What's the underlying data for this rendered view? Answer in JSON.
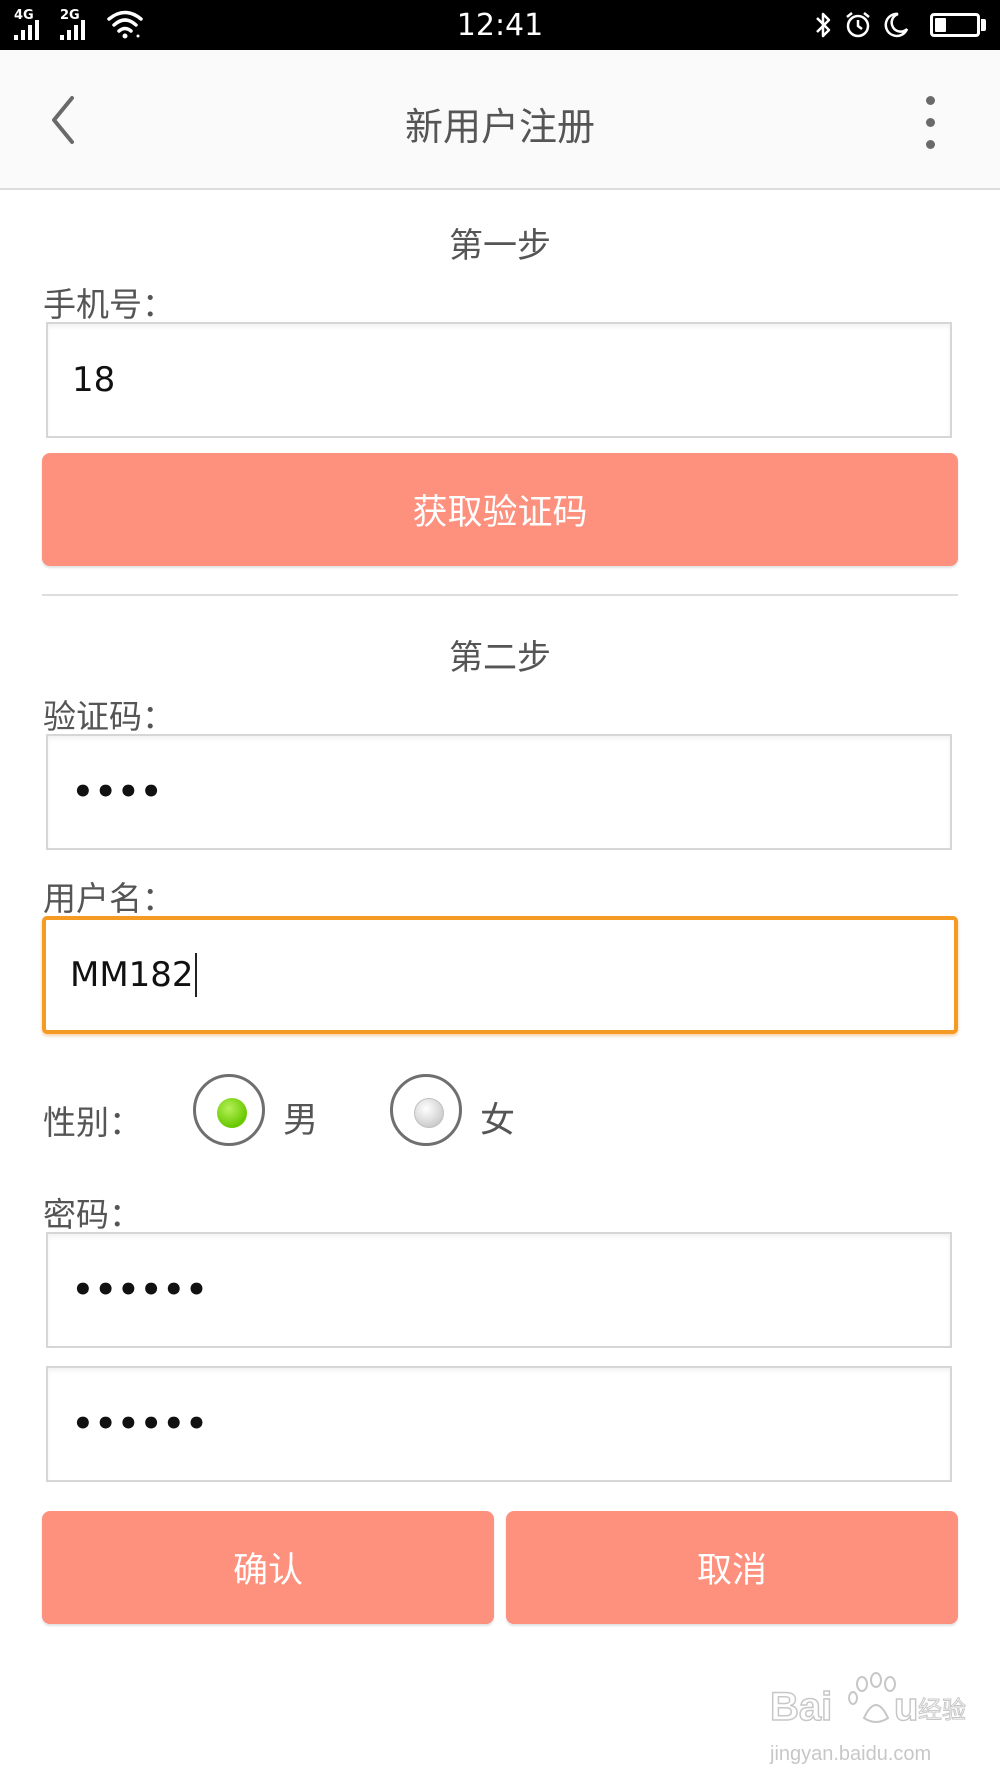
{
  "status_bar": {
    "network_1": "4G",
    "network_2": "2G",
    "time": "12:41",
    "battery_level": 0.25
  },
  "app_bar": {
    "title": "新用户注册",
    "back_icon": "chevron-left-icon",
    "menu_icon": "more-vert-icon"
  },
  "step1": {
    "title": "第一步",
    "phone_label": "手机号：",
    "phone_value": "18",
    "get_code_label": "获取验证码"
  },
  "step2": {
    "title": "第二步",
    "code_label": "验证码：",
    "code_value": "••••",
    "username_label": "用户名：",
    "username_value": "MM182",
    "gender_label": "性别：",
    "gender_options": [
      {
        "label": "男",
        "selected": true
      },
      {
        "label": "女",
        "selected": false
      }
    ],
    "password_label": "密码：",
    "password_value": "••••••",
    "password_confirm_value": "••••••"
  },
  "actions": {
    "confirm_label": "确认",
    "cancel_label": "取消"
  },
  "watermark": {
    "brand": "Baidu经验",
    "url": "jingyan.baidu.com"
  },
  "colors": {
    "accent_button": "#fe907e",
    "focus_border": "#f59a23",
    "radio_selected": "#68c800"
  }
}
